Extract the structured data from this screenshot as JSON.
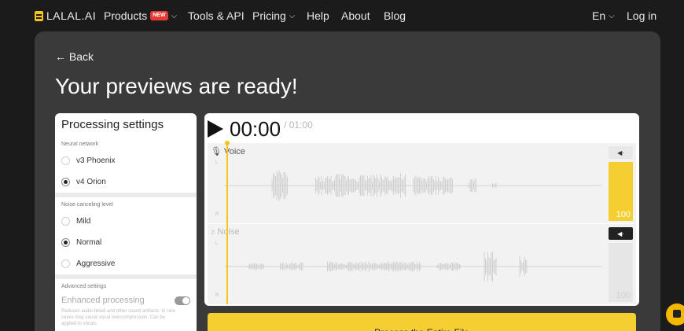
{
  "nav": {
    "logo": "LALAL.AI",
    "products": "Products",
    "products_badge": "NEW",
    "tools": "Tools & API",
    "pricing": "Pricing",
    "help": "Help",
    "about": "About",
    "blog": "Blog",
    "language": "En",
    "login": "Log in"
  },
  "page": {
    "back": "← Back",
    "title": "Your previews are ready!"
  },
  "settings": {
    "title": "Processing settings",
    "neural_label": "Neural network",
    "neural_options": [
      "v3 Phoenix",
      "v4 Orion"
    ],
    "neural_selected": "v4 Orion",
    "noise_label": "Noise canceling level",
    "noise_options": [
      "Mild",
      "Normal",
      "Aggressive"
    ],
    "noise_selected": "Normal",
    "advanced_label": "Advanced settings",
    "enhanced_label": "Enhanced processing",
    "enhanced_desc": "Reduces audio bleed and other sound artifacts. In rare cases may cause vocal overcompression. Can be applied to vocals."
  },
  "player": {
    "current_time": "00:00",
    "total_time": "/ 01:00",
    "progress": 0,
    "tracks": [
      {
        "name": "Voice",
        "volume": "100",
        "muted": false
      },
      {
        "name": "Noise",
        "volume": "100",
        "muted": true
      }
    ],
    "left_channel": "L",
    "right_channel": "R",
    "accent_color": "#f5cf2f"
  },
  "process_button": "Process the Entire File",
  "icons": {
    "play": "play-icon",
    "mute": "speaker-icon",
    "chat": "chat-icon"
  }
}
